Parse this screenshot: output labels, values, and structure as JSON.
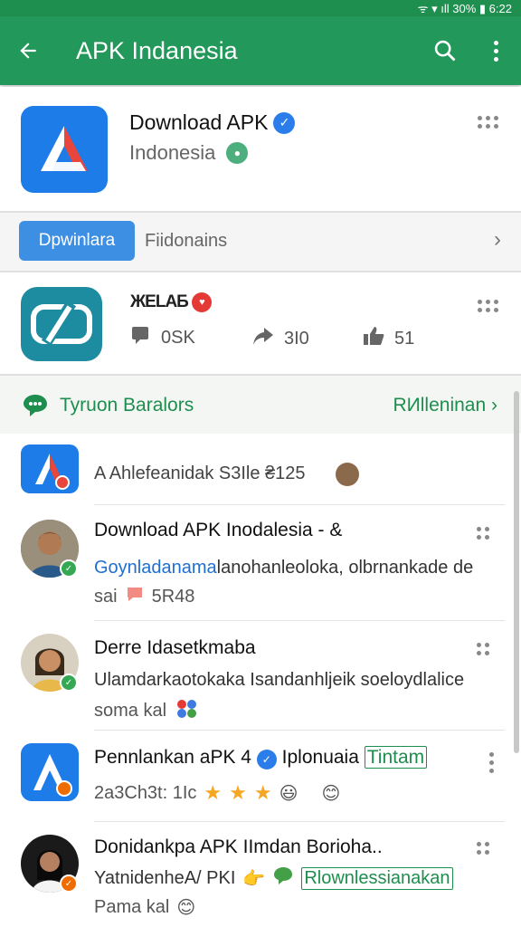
{
  "status_bar": {
    "right_text": "ᯤ ▾ ıll 30% ▮ 6:22"
  },
  "app_bar": {
    "title": "APK Indanesia"
  },
  "featured": {
    "name": "Download APK",
    "subtitle": "Indonesia"
  },
  "tabs": {
    "active": "Dpwinlara",
    "second": "Fiidonains"
  },
  "featured2": {
    "name": "ЖЕLAБ",
    "stats": [
      {
        "icon": "comment-icon",
        "value": "0SK"
      },
      {
        "icon": "share-icon",
        "value": "3I0"
      },
      {
        "icon": "like-icon",
        "value": "51"
      }
    ]
  },
  "section": {
    "title": "Tyruon Baralors",
    "link": "RИlleninan"
  },
  "list": [
    {
      "kind": "app",
      "title": "A Ahlefeanidak S3Ile ₴125"
    },
    {
      "kind": "person",
      "title": "Download APK Inodalesia - &",
      "body_blue": "Goynladanama",
      "body": "lanohanleoloka, olbrnankade de",
      "meta": "sai",
      "meta_tag": "5R48"
    },
    {
      "kind": "person",
      "title": "Derre Idasetkmaba",
      "body": "Ulamdarkaotokaka Isandanhljeik soeloydlalice",
      "meta": "soma kal"
    },
    {
      "kind": "app",
      "title": "Pennlankan aPK 4",
      "title_tail": "Iplonuaia",
      "title_green": "Tintam",
      "meta": "2a3Ch3t: 1Ic"
    },
    {
      "kind": "person",
      "title": "Donidankpa APK IImdan Borioha..",
      "body": "YatnidenheA/ PKI",
      "body_green": "Rlownlessianakan",
      "meta": "Pama kal"
    }
  ],
  "colors": {
    "primary": "#22985a",
    "accent": "#3d8fe3"
  }
}
